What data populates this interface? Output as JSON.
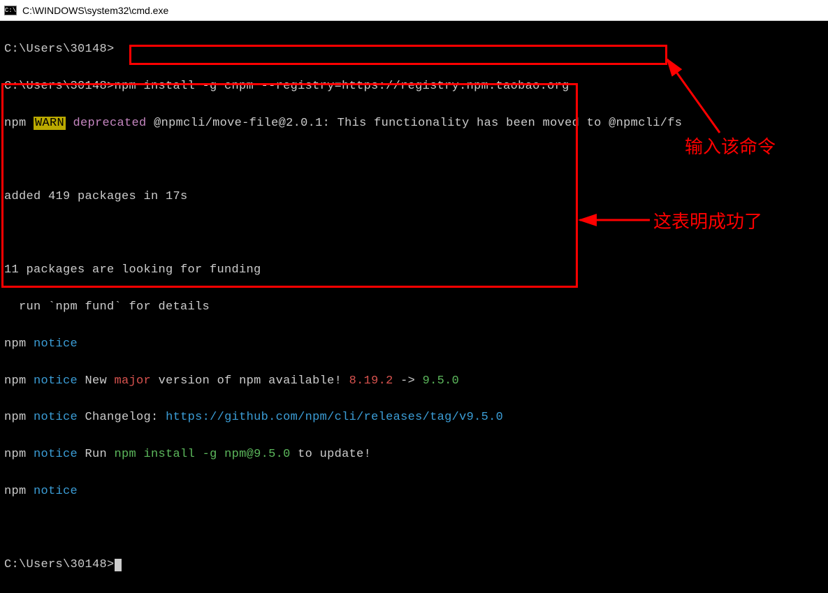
{
  "window": {
    "icon_label": "C:\\",
    "title": "C:\\WINDOWS\\system32\\cmd.exe"
  },
  "terminal": {
    "line1_prompt": "C:\\Users\\30148>",
    "line2_prompt": "C:\\Users\\30148>",
    "line2_cmd": "npm install -g cnpm --registry=https://registry.npm.taobao.org",
    "line3_npm": "npm ",
    "line3_warn": "WARN",
    "line3_space": " ",
    "line3_deprecated": "deprecated",
    "line3_rest": " @npmcli/move-file@2.0.1: This functionality has been moved to @npmcli/fs",
    "line5": "added 419 packages in 17s",
    "line7": "11 packages are looking for funding",
    "line8": "  run `npm fund` for details",
    "line9_npm": "npm ",
    "line9_notice": "notice",
    "line10_npm": "npm ",
    "line10_notice": "notice",
    "line10_text1": " New ",
    "line10_major": "major",
    "line10_text2": " version of npm available! ",
    "line10_old": "8.19.2",
    "line10_arrow": " -> ",
    "line10_new": "9.5.0",
    "line11_npm": "npm ",
    "line11_notice": "notice",
    "line11_text": " Changelog: ",
    "line11_url": "https://github.com/npm/cli/releases/tag/v9.5.0",
    "line12_npm": "npm ",
    "line12_notice": "notice",
    "line12_text1": " Run ",
    "line12_cmd": "npm install -g npm@9.5.0",
    "line12_text2": " to update!",
    "line13_npm": "npm ",
    "line13_notice": "notice",
    "line15_prompt": "C:\\Users\\30148>"
  },
  "annotations": {
    "label1": "输入该命令",
    "label2": "这表明成功了"
  }
}
